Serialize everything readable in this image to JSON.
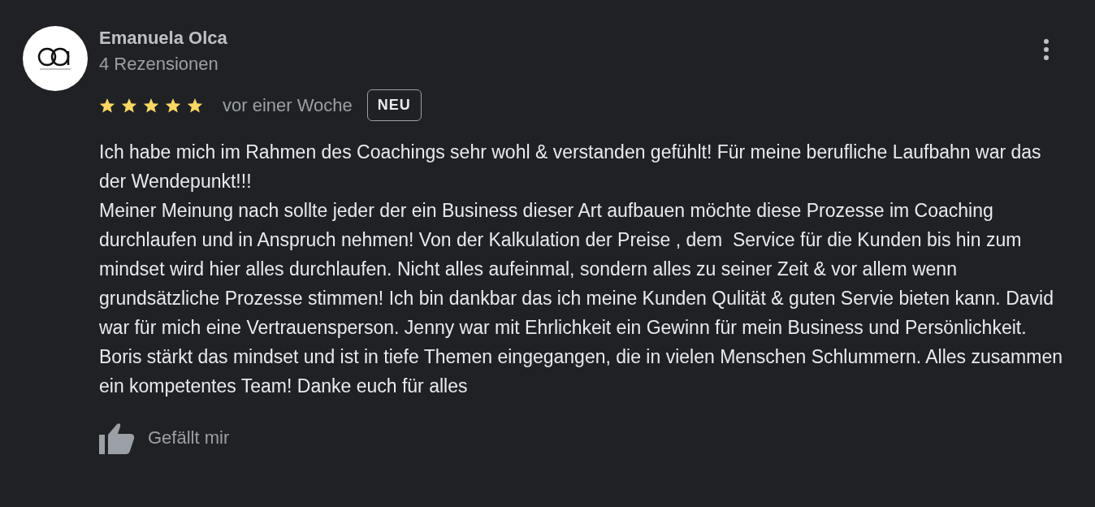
{
  "review": {
    "author": "Emanuela Olca",
    "reviews_count": "4 Rezensionen",
    "stars": 5,
    "time": "vor einer Woche",
    "badge": "NEU",
    "text": "Ich habe mich im Rahmen des Coachings sehr wohl & verstanden gefühlt! Für meine berufliche Laufbahn war das der Wendepunkt!!!\nMeiner Meinung nach sollte jeder der ein Business dieser Art aufbauen möchte diese Prozesse im Coaching durchlaufen und in Anspruch nehmen! Von der Kalkulation der Preise , dem  Service für die Kunden bis hin zum mindset wird hier alles durchlaufen. Nicht alles aufeinmal, sondern alles zu seiner Zeit & vor allem wenn grundsätzliche Prozesse stimmen! Ich bin dankbar das ich meine Kunden Qulität & guten Servie bieten kann. David war für mich eine Vertrauensperson. Jenny war mit Ehrlichkeit ein Gewinn für mein Business und Persönlichkeit. Boris stärkt das mindset und ist in tiefe Themen eingegangen, die in vielen Menschen Schlummern. Alles zusammen ein kompetentes Team! Danke euch für alles",
    "like_label": "Gefällt mir"
  }
}
